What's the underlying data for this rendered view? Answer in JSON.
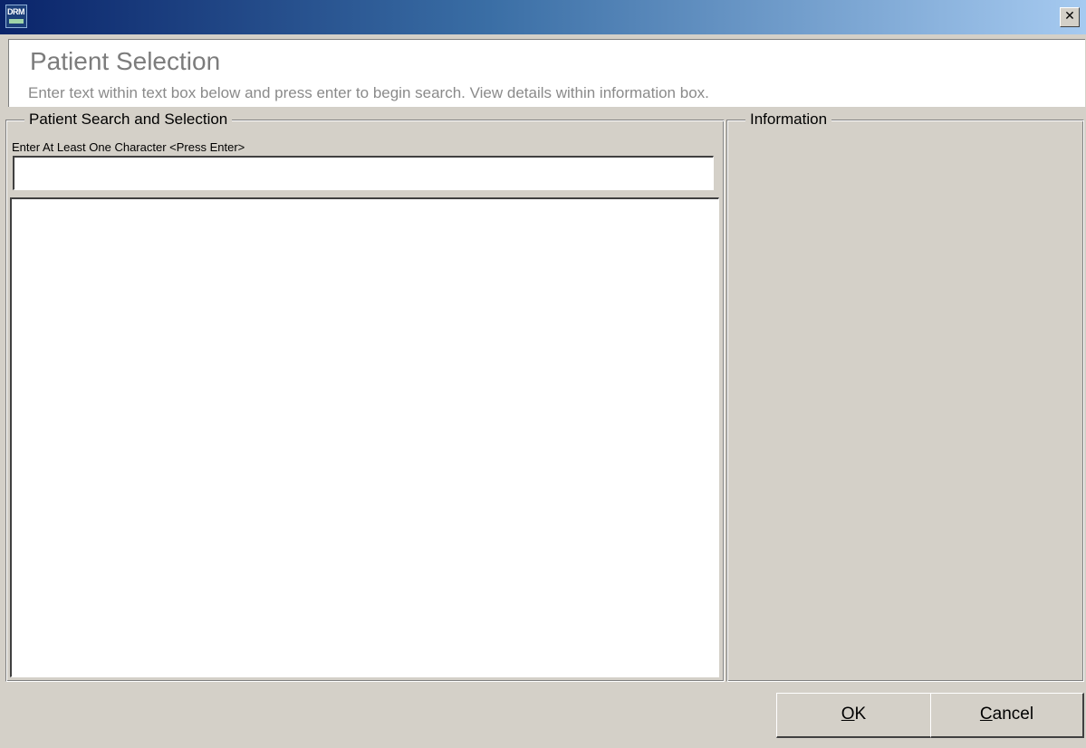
{
  "window": {
    "close_symbol": "✕",
    "icon": {
      "name": "drm-app-icon",
      "text": "DRM"
    }
  },
  "header": {
    "title": "Patient Selection",
    "subtitle": "Enter text within text box below and press enter to begin search.  View details within information box."
  },
  "search_group": {
    "legend": "Patient Search and Selection",
    "input_label": "Enter At Least One Character  <Press Enter>",
    "input_value": ""
  },
  "info_group": {
    "legend": "Information"
  },
  "buttons": {
    "ok": {
      "accel": "O",
      "rest": "K"
    },
    "cancel": {
      "accel": "C",
      "rest": "ancel"
    }
  },
  "colors": {
    "titlebar_start": "#0a246a",
    "titlebar_end": "#a6caf0",
    "face": "#d4d0c8"
  }
}
